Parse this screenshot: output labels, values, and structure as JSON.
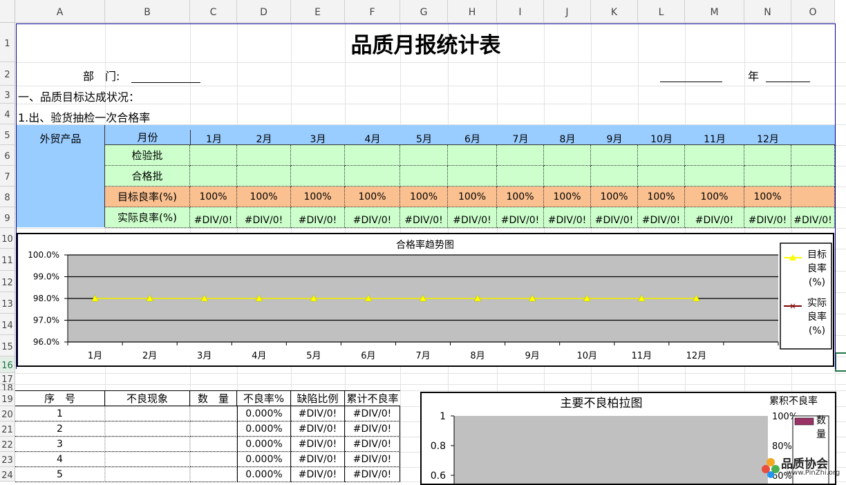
{
  "columns": [
    "A",
    "B",
    "C",
    "D",
    "E",
    "F",
    "G",
    "H",
    "I",
    "J",
    "K",
    "L",
    "M",
    "N",
    "O"
  ],
  "rows": [
    "1",
    "2",
    "3",
    "4",
    "5",
    "6",
    "7",
    "8",
    "9",
    "10",
    "11",
    "12",
    "13",
    "14",
    "15",
    "16",
    "17",
    "18",
    "19",
    "20",
    "21",
    "22",
    "23",
    "24"
  ],
  "selected_row": "16",
  "sheet": {
    "title": "品质月报统计表",
    "dept_label": "部　门:",
    "year_label": "年",
    "section1": "一、品质目标达成状况：",
    "section1_1": "1.出、验货抽检一次合格率",
    "product_label": "外贸产品",
    "month_label": "月份",
    "months": [
      "1月",
      "2月",
      "3月",
      "4月",
      "5月",
      "6月",
      "7月",
      "8月",
      "9月",
      "10月",
      "11月",
      "12月"
    ],
    "row_inspect": "检验批",
    "row_pass": "合格批",
    "row_target": "目标良率(%)",
    "row_actual": "实际良率(%)",
    "target_values": [
      "100%",
      "100%",
      "100%",
      "100%",
      "100%",
      "100%",
      "100%",
      "100%",
      "100%",
      "100%",
      "100%",
      "100%"
    ],
    "actual_values": [
      "#DIV/0!",
      "#DIV/0!",
      "#DIV/0!",
      "#DIV/0!",
      "#DIV/0!",
      "#DIV/0!",
      "#DIV/0!",
      "#DIV/0!",
      "#DIV/0!",
      "#DIV/0!",
      "#DIV/0!",
      "#DIV/0!",
      "#DIV/0!"
    ]
  },
  "chart_data": [
    {
      "type": "line",
      "title": "合格率趋势图",
      "categories": [
        "1月",
        "2月",
        "3月",
        "4月",
        "5月",
        "6月",
        "7月",
        "8月",
        "9月",
        "10月",
        "11月",
        "12月"
      ],
      "yticks": [
        "96.0%",
        "97.0%",
        "98.0%",
        "99.0%",
        "100.0%"
      ],
      "ylim": [
        96.0,
        100.0
      ],
      "series": [
        {
          "name": "目标良率(%)",
          "values": [
            98,
            98,
            98,
            98,
            98,
            98,
            98,
            98,
            98,
            98,
            98,
            98
          ],
          "color": "#ffff00",
          "marker": "triangle"
        },
        {
          "name": "实际良率(%)",
          "values": [],
          "color": "#800000",
          "marker": "x"
        }
      ],
      "legend": {
        "position": "right",
        "items": [
          [
            "目标",
            "良率",
            "(%)"
          ],
          [
            "实际",
            "良率",
            "(%)"
          ]
        ]
      },
      "plot_bg": "#c0c0c0",
      "grid": true
    },
    {
      "type": "bar",
      "title": "主要不良柏拉图",
      "right_axis_title": "累积不良率",
      "yticks": [
        "0.6",
        "0.8",
        "1"
      ],
      "right_ticks": [
        "60%",
        "80%",
        "100%"
      ],
      "series": [
        {
          "name": "数量",
          "color": "#993366",
          "values": []
        }
      ],
      "legend_text": [
        "数",
        "量"
      ]
    }
  ],
  "defects_table": {
    "headers": [
      "序　号",
      "不良现象",
      "数　量",
      "不良率%",
      "缺陷比例",
      "累计不良率"
    ],
    "rows": [
      [
        "1",
        "",
        "",
        "0.000%",
        "#DIV/0!",
        "#DIV/0!"
      ],
      [
        "2",
        "",
        "",
        "0.000%",
        "#DIV/0!",
        "#DIV/0!"
      ],
      [
        "3",
        "",
        "",
        "0.000%",
        "#DIV/0!",
        "#DIV/0!"
      ],
      [
        "4",
        "",
        "",
        "0.000%",
        "#DIV/0!",
        "#DIV/0!"
      ],
      [
        "5",
        "",
        "",
        "0.000%",
        "#DIV/0!",
        "#DIV/0!"
      ]
    ]
  },
  "watermark": {
    "text": "品质协会",
    "url": "www.PinZhi.org"
  }
}
